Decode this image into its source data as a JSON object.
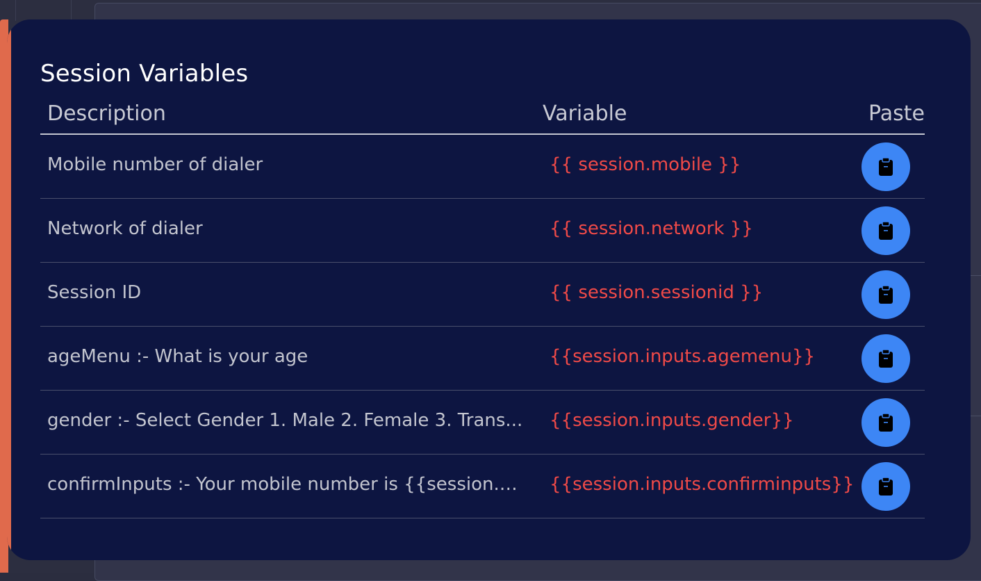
{
  "modal": {
    "title": "Session Variables"
  },
  "table": {
    "headers": {
      "description": "Description",
      "variable": "Variable",
      "paste": "Paste"
    },
    "rows": [
      {
        "description": "Mobile number of dialer",
        "variable": "{{ session.mobile }}"
      },
      {
        "description": "Network of dialer",
        "variable": "{{ session.network }}"
      },
      {
        "description": "Session ID",
        "variable": "{{ session.sessionid }}"
      },
      {
        "description": "ageMenu :- What is your age",
        "variable": "{{session.inputs.agemenu}}"
      },
      {
        "description": "gender :- Select Gender 1. Male 2. Female 3. Trans...",
        "variable": "{{session.inputs.gender}}"
      },
      {
        "description": "confirmInputs :- Your mobile number is {{session.m...",
        "variable": "{{session.inputs.confirminputs}}"
      }
    ]
  },
  "colors": {
    "modal_background": "#0d1541",
    "variable_text": "#f04a48",
    "paste_button": "#3d86f5",
    "accent": "#e06a4c"
  },
  "icons": {
    "paste": "clipboard-icon"
  }
}
